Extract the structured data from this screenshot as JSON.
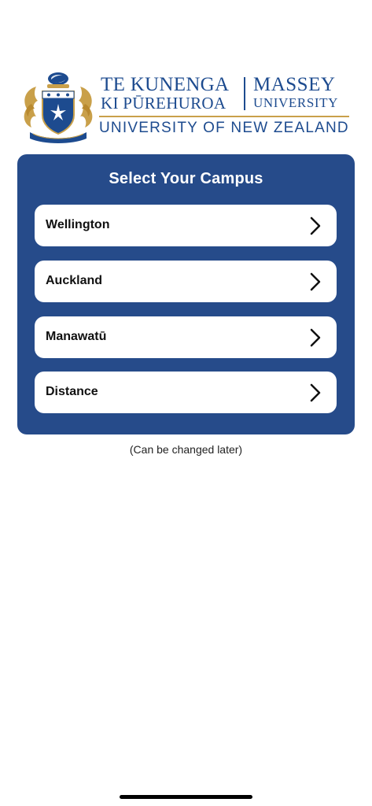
{
  "logo": {
    "maori_line_1": "TE KUNENGA",
    "maori_line_2": "KI PŪREHUROA",
    "english_line_1": "MASSEY",
    "english_line_2": "UNIVERSITY",
    "subtitle": "UNIVERSITY OF NEW ZEALAND",
    "colors": {
      "blue": "#1d4b8f",
      "gold": "#c9a04a"
    }
  },
  "campus_select": {
    "title": "Select Your Campus",
    "options": [
      {
        "label": "Wellington",
        "icon": "chevron-right-icon"
      },
      {
        "label": "Auckland",
        "icon": "chevron-right-icon"
      },
      {
        "label": "Manawatū",
        "icon": "chevron-right-icon"
      },
      {
        "label": "Distance",
        "icon": "chevron-right-icon"
      }
    ],
    "card_color": "#264b8a"
  },
  "note": "(Can be changed later)"
}
